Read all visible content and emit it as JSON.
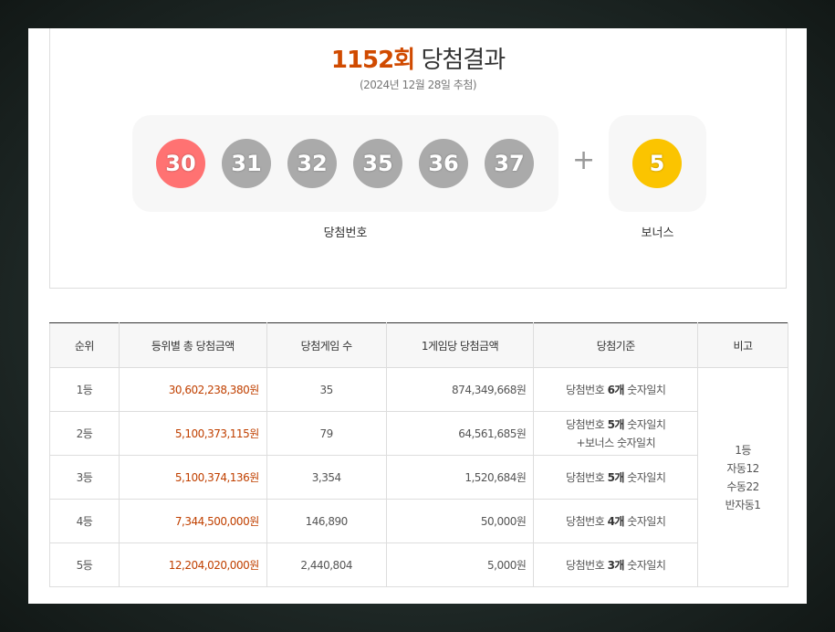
{
  "header": {
    "round": "1152회",
    "title_rest": "당첨결과",
    "draw_date": "(2024년 12월 28일 추첨)"
  },
  "numbers": {
    "balls": [
      "30",
      "31",
      "32",
      "35",
      "36",
      "37"
    ],
    "ball_colors": [
      "#ff7272",
      "#aaaaaa",
      "#aaaaaa",
      "#aaaaaa",
      "#aaaaaa",
      "#aaaaaa"
    ],
    "plus": "+",
    "bonus": "5",
    "bonus_color": "#fbc400",
    "label_win": "당첨번호",
    "label_bonus": "보너스"
  },
  "table": {
    "headers": [
      "순위",
      "등위별 총 당첨금액",
      "당첨게임 수",
      "1게임당 당첨금액",
      "당첨기준",
      "비고"
    ],
    "rows": [
      {
        "rank": "1등",
        "total": "30,602,238,380원",
        "games": "35",
        "per_game": "874,349,668원",
        "std_pre": "당첨번호 ",
        "std_bold": "6개",
        "std_post": " 숫자일치",
        "std_line2": ""
      },
      {
        "rank": "2등",
        "total": "5,100,373,115원",
        "games": "79",
        "per_game": "64,561,685원",
        "std_pre": "당첨번호 ",
        "std_bold": "5개",
        "std_post": " 숫자일치",
        "std_line2": "+보너스 숫자일치"
      },
      {
        "rank": "3등",
        "total": "5,100,374,136원",
        "games": "3,354",
        "per_game": "1,520,684원",
        "std_pre": "당첨번호 ",
        "std_bold": "5개",
        "std_post": " 숫자일치",
        "std_line2": ""
      },
      {
        "rank": "4등",
        "total": "7,344,500,000원",
        "games": "146,890",
        "per_game": "50,000원",
        "std_pre": "당첨번호 ",
        "std_bold": "4개",
        "std_post": " 숫자일치",
        "std_line2": ""
      },
      {
        "rank": "5등",
        "total": "12,204,020,000원",
        "games": "2,440,804",
        "per_game": "5,000원",
        "std_pre": "당첨번호 ",
        "std_bold": "3개",
        "std_post": " 숫자일치",
        "std_line2": ""
      }
    ],
    "note_lines": [
      "1등",
      "자동12",
      "수동22",
      "반자동1"
    ]
  }
}
